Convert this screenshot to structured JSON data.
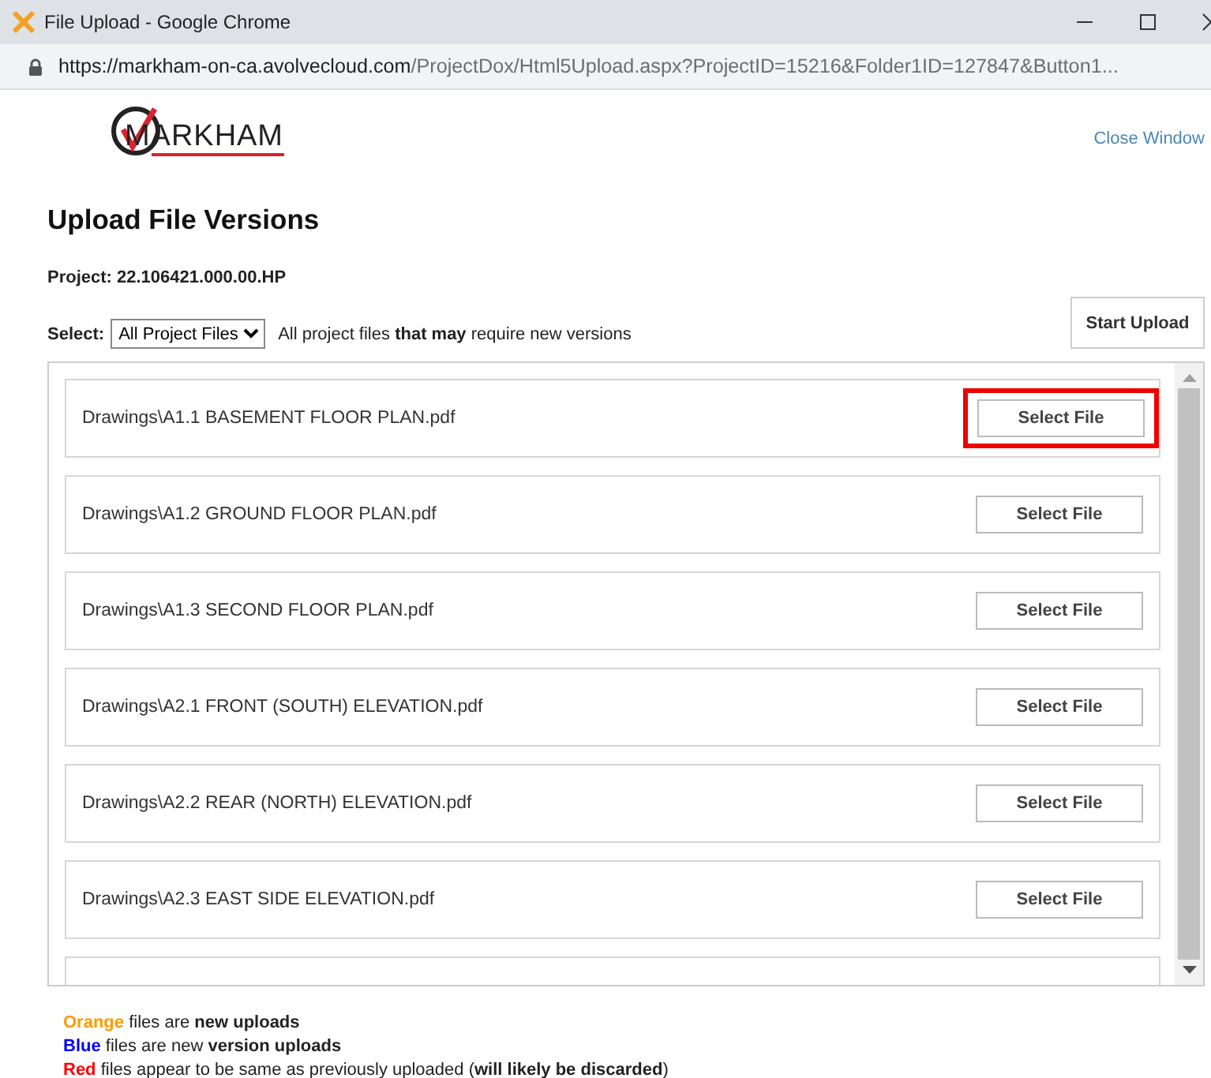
{
  "window": {
    "title": "File Upload - Google Chrome",
    "url_host": "https://markham-on-ca.avolvecloud.com",
    "url_path": "/ProjectDox/Html5Upload.aspx?ProjectID=15216&Folder1ID=127847&Button1..."
  },
  "header": {
    "logo_text": "MARKHAM",
    "close_link": "Close Window"
  },
  "title": "Upload File Versions",
  "project": "Project: 22.106421.000.00.HP",
  "filter": {
    "label": "Select:",
    "value": "All Project Files",
    "description": "All project files **that may** require new versions"
  },
  "start_button": "Start Upload",
  "files": [
    {
      "kind": "file",
      "name": "Drawings\\A1.1 BASEMENT FLOOR PLAN.pdf",
      "button": "Select File",
      "highlighted": true
    },
    {
      "kind": "file",
      "name": "Drawings\\A1.2 GROUND FLOOR PLAN.pdf",
      "button": "Select File",
      "highlighted": false
    },
    {
      "kind": "file",
      "name": "Drawings\\A1.3 SECOND FLOOR PLAN.pdf",
      "button": "Select File",
      "highlighted": false
    },
    {
      "kind": "file",
      "name": "Drawings\\A2.1 FRONT (SOUTH) ELEVATION.pdf",
      "button": "Select File",
      "highlighted": false
    },
    {
      "kind": "file",
      "name": "Drawings\\A2.2 REAR (NORTH) ELEVATION.pdf",
      "button": "Select File",
      "highlighted": false
    },
    {
      "kind": "file",
      "name": "Drawings\\A2.3 EAST SIDE ELEVATION.pdf",
      "button": "Select File",
      "highlighted": false
    },
    {
      "kind": "partial"
    }
  ],
  "legend": [
    {
      "word": "Orange",
      "color": "#ff9900",
      "text": "files are **new uploads**"
    },
    {
      "word": "Blue",
      "color": "#0000ff",
      "text": "files are new **version uploads**"
    },
    {
      "word": "Red",
      "color": "#ff0000",
      "text": "files appear to be same as previously uploaded (**will likely be discarded**)"
    }
  ]
}
